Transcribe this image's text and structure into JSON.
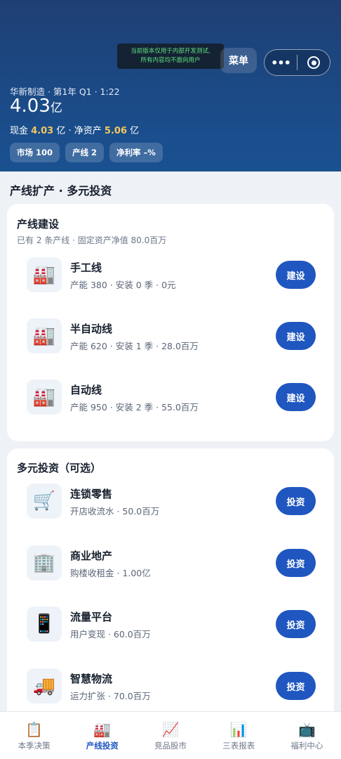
{
  "header": {
    "dev_notice_line1": "当前版本仅用于内部开发测试,",
    "dev_notice_line2": "所有内容均不面向用户",
    "menu_label": "菜单",
    "more_icon": "•••",
    "company_line": "华新制造 · 第1年 Q1 · 1:22",
    "big_value": "4.03",
    "big_unit": "亿",
    "cash_label": "现金",
    "cash_value": "4.03",
    "cash_unit": "亿 · 净资产",
    "net_assets_value": "5.06",
    "net_assets_unit": "亿",
    "chips": [
      "市场 100",
      "产线 2",
      "净利率 –%"
    ]
  },
  "section_title": "产线扩产 · 多元投资",
  "production_card": {
    "title": "产线建设",
    "subtitle": "已有 2 条产线 · 固定资产净值 80.0百万",
    "items": [
      {
        "name": "手工线",
        "desc": "产能 380 · 安装 0 季 · 0元",
        "button": "建设",
        "icon": "🏭"
      },
      {
        "name": "半自动线",
        "desc": "产能 620 · 安装 1 季 · 28.0百万",
        "button": "建设",
        "icon": "🏭"
      },
      {
        "name": "自动线",
        "desc": "产能 950 · 安装 2 季 · 55.0百万",
        "button": "建设",
        "icon": "🏭"
      }
    ]
  },
  "invest_card": {
    "title": "多元投资（可选）",
    "items": [
      {
        "name": "连锁零售",
        "desc": "开店收流水 · 50.0百万",
        "button": "投资",
        "icon": "🛒"
      },
      {
        "name": "商业地产",
        "desc": "购楼收租金 · 1.00亿",
        "button": "投资",
        "icon": "🏢"
      },
      {
        "name": "流量平台",
        "desc": "用户变现 · 60.0百万",
        "button": "投资",
        "icon": "📱"
      },
      {
        "name": "智慧物流",
        "desc": "运力扩张 · 70.0百万",
        "button": "投资",
        "icon": "🚚"
      }
    ]
  },
  "tabbar": [
    {
      "label": "本季决策",
      "icon": "📋",
      "active": false
    },
    {
      "label": "产线投资",
      "icon": "🏭",
      "active": true
    },
    {
      "label": "竞品股市",
      "icon": "📈",
      "active": false
    },
    {
      "label": "三表报表",
      "icon": "📊",
      "active": false
    },
    {
      "label": "福利中心",
      "icon": "📺",
      "active": false
    }
  ],
  "colors": {
    "primary": "#1f56c0",
    "header_top": "#1e3f73",
    "gold": "#f3c760"
  }
}
